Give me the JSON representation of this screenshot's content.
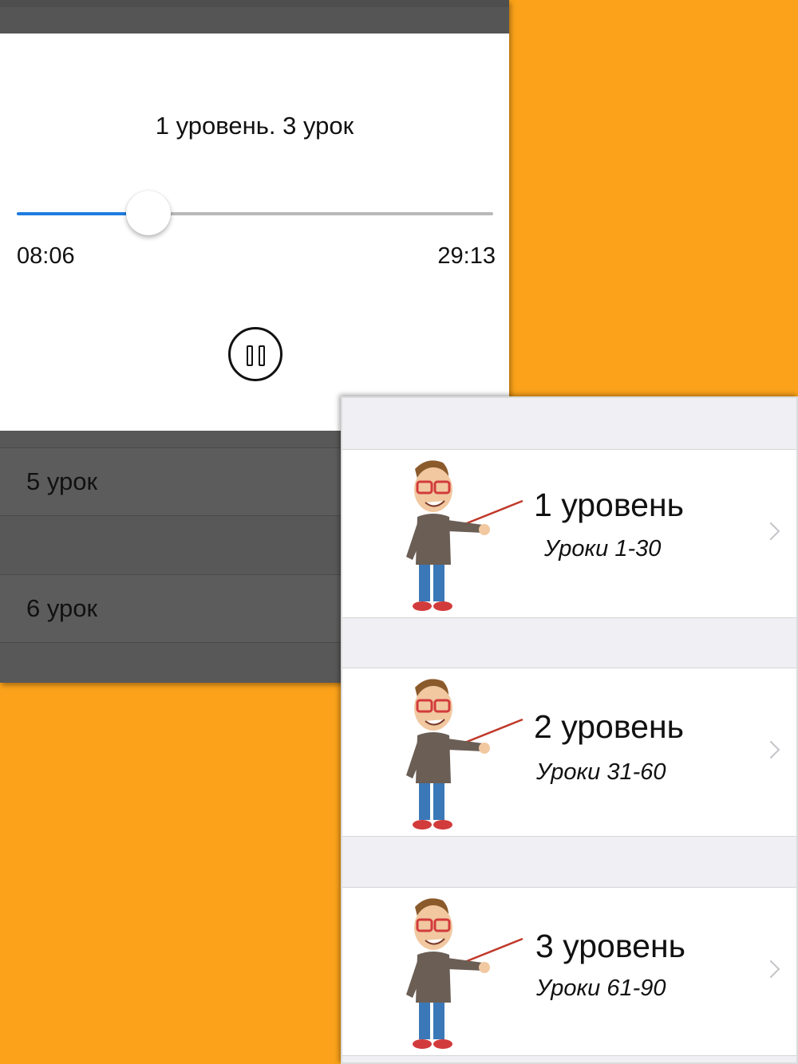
{
  "player": {
    "title": "1 уровень. 3 урок",
    "elapsed": "08:06",
    "total": "29:13",
    "progress_fraction": 0.277,
    "accent_color": "#1f7ce0",
    "pause_icon": "pause-circle-icon"
  },
  "lesson_list": {
    "items": [
      {
        "label": "5 урок"
      },
      {
        "label": "6 урок"
      }
    ]
  },
  "levels": {
    "items": [
      {
        "title": "1 уровень",
        "subtitle": "Уроки 1-30",
        "icon": "teacher-pointer-illustration"
      },
      {
        "title": "2 уровень",
        "subtitle": "Уроки 31-60",
        "icon": "teacher-pointer-illustration"
      },
      {
        "title": "3 уровень",
        "subtitle": "Уроки 61-90",
        "icon": "teacher-pointer-illustration"
      }
    ],
    "chevron_icon": "chevron-right-icon"
  },
  "colors": {
    "background": "#FBA21A",
    "dark_panel": "#5a5a5a"
  }
}
